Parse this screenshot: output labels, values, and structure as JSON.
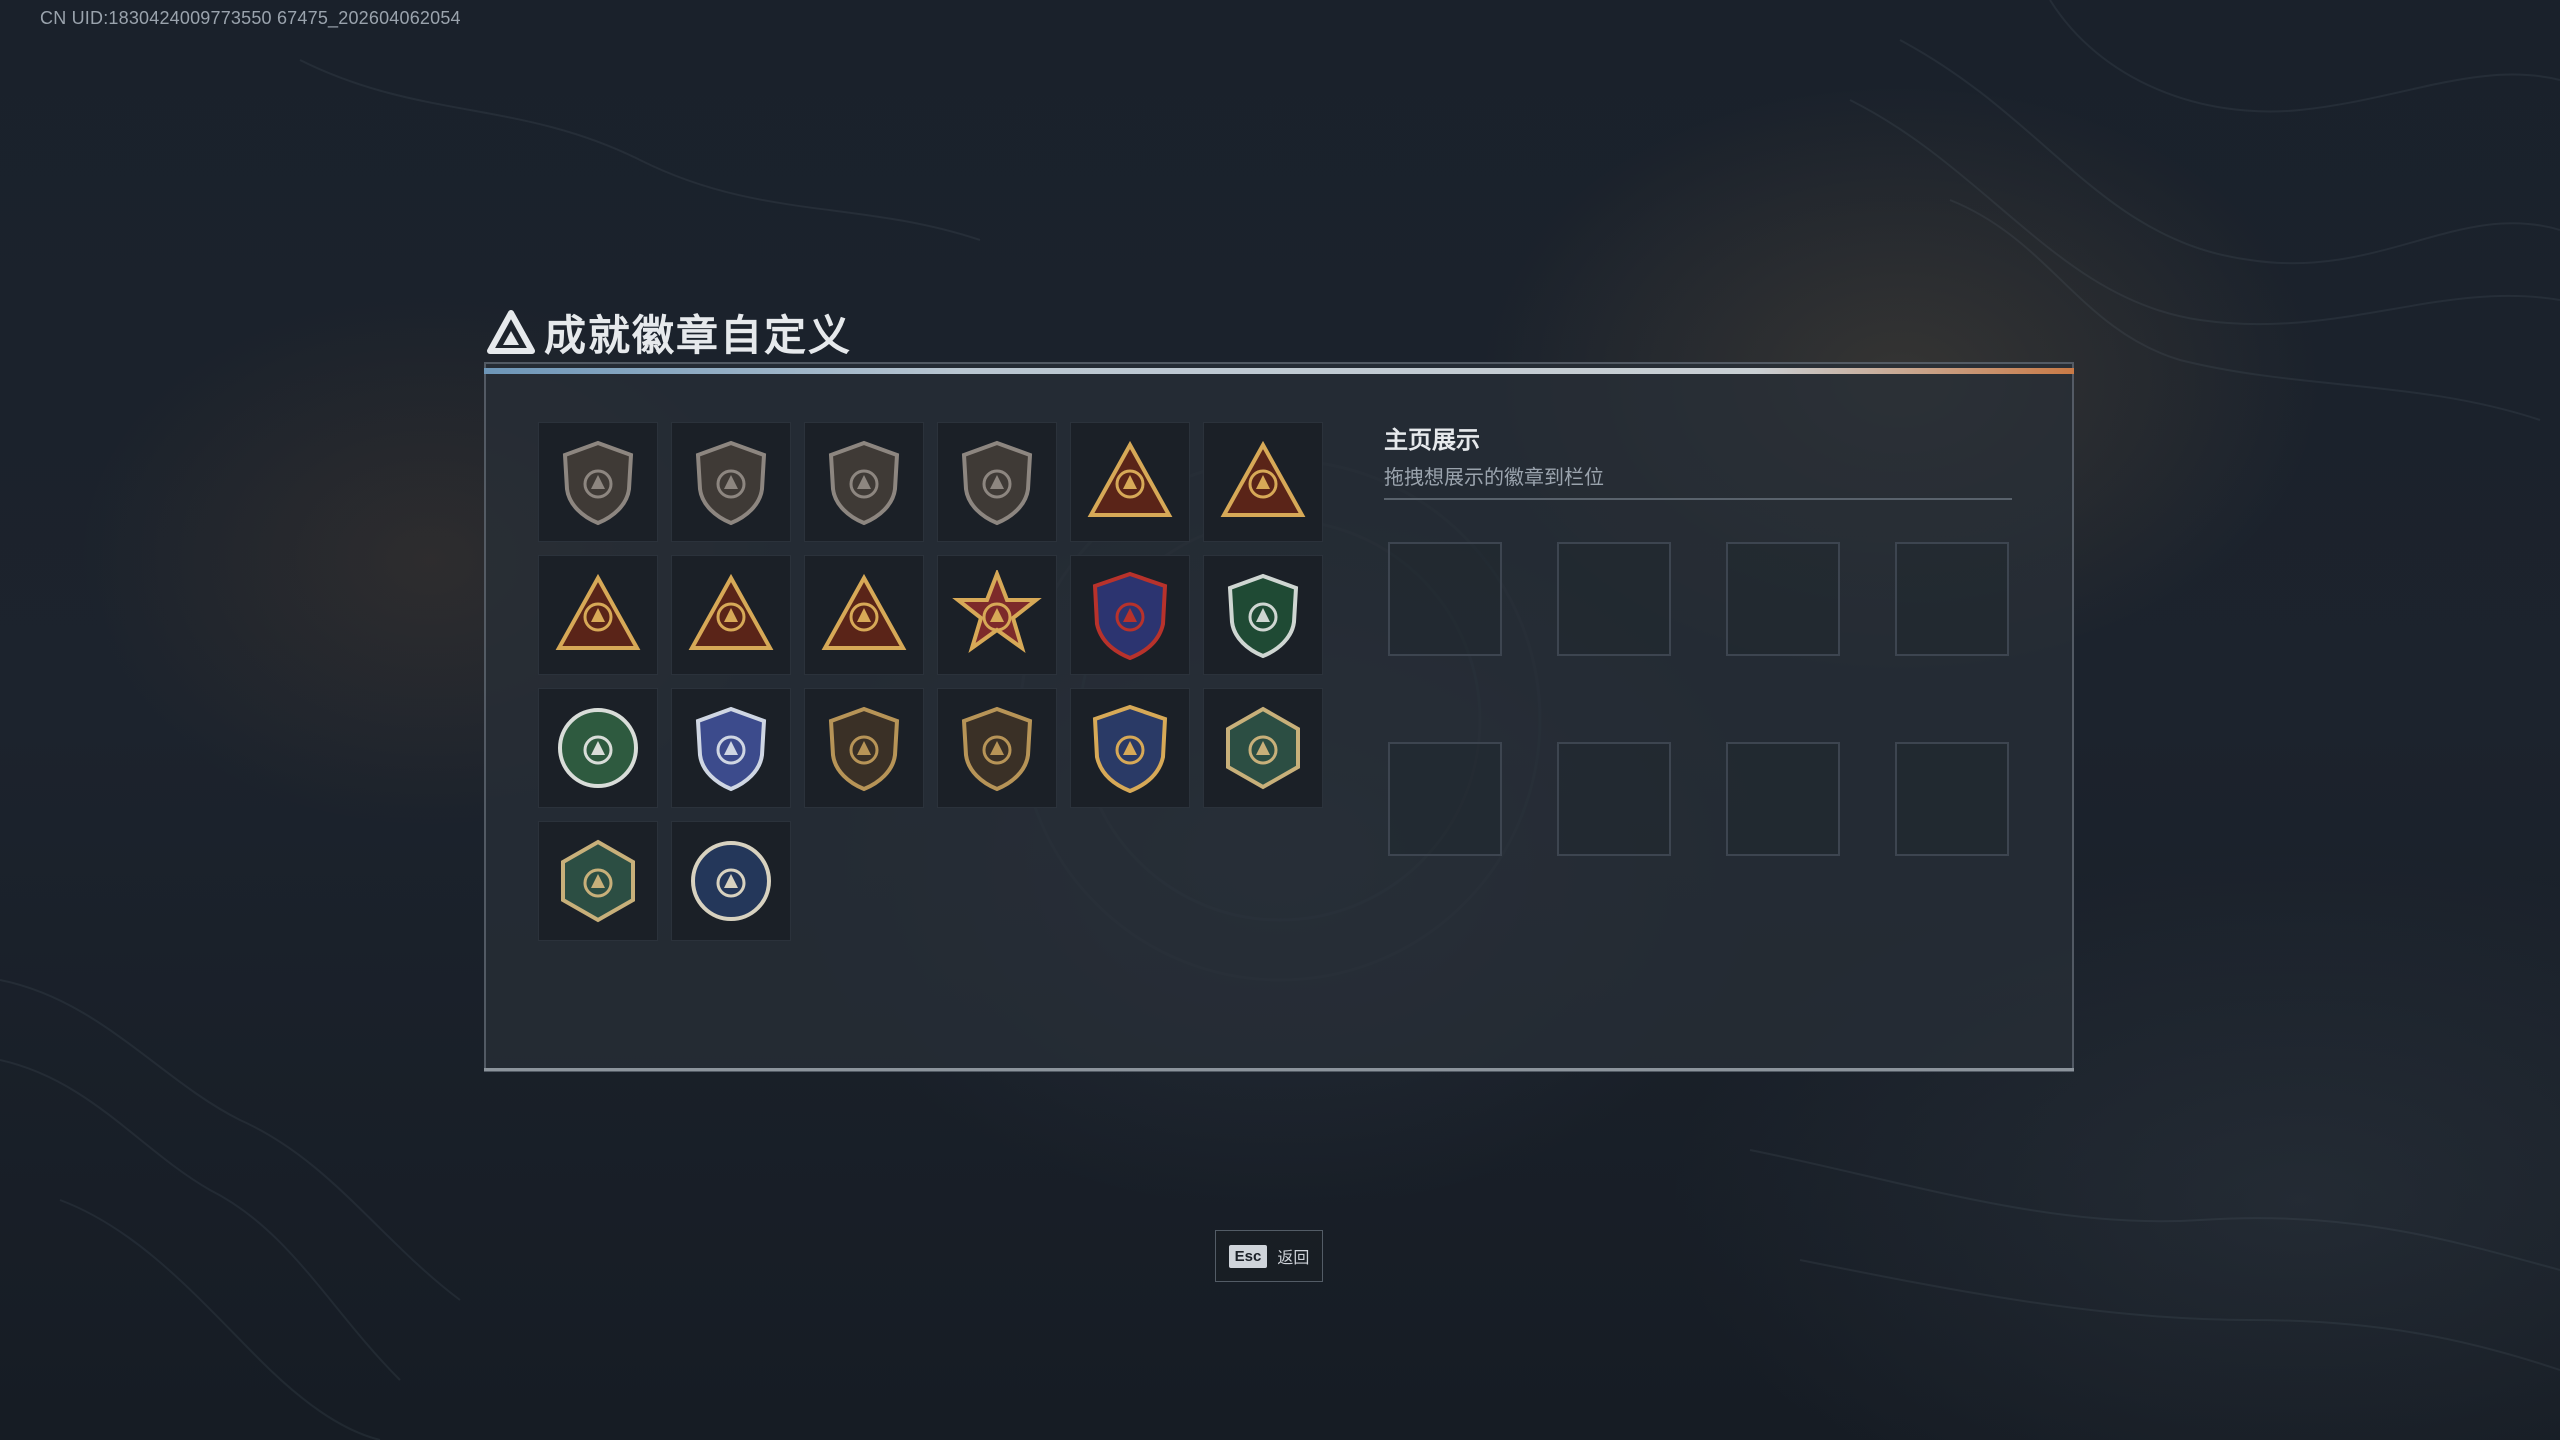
{
  "uid_text": "CN UID:1830424009773550 67475_202604062054",
  "page": {
    "title": "成就徽章自定义"
  },
  "badges": [
    {
      "name": "badge-delta-shield",
      "colors": [
        "#3f3a36",
        "#8d8680"
      ]
    },
    {
      "name": "badge-helicopter-shield",
      "colors": [
        "#3f3a36",
        "#8d8680"
      ]
    },
    {
      "name": "badge-diamond-shield",
      "colors": [
        "#3f3a36",
        "#8d8680"
      ]
    },
    {
      "name": "badge-dagger-shield",
      "colors": [
        "#3f3a36",
        "#8d8680"
      ]
    },
    {
      "name": "badge-gold-tower",
      "colors": [
        "#5a2418",
        "#d7a957"
      ]
    },
    {
      "name": "badge-gold-helmet",
      "colors": [
        "#5a2418",
        "#d7a957"
      ]
    },
    {
      "name": "badge-gold-tank",
      "colors": [
        "#5a2418",
        "#d7a957"
      ]
    },
    {
      "name": "badge-gold-number-one",
      "colors": [
        "#5a2418",
        "#d7a957"
      ]
    },
    {
      "name": "badge-gold-soldier",
      "colors": [
        "#5a2418",
        "#d7a957"
      ]
    },
    {
      "name": "badge-star-medal",
      "colors": [
        "#7d2a2a",
        "#d7a957"
      ]
    },
    {
      "name": "badge-crest-medal",
      "colors": [
        "#2c3470",
        "#b8322b"
      ]
    },
    {
      "name": "badge-green-shield",
      "colors": [
        "#1f4a34",
        "#cfd6d2"
      ]
    },
    {
      "name": "badge-green-skull",
      "colors": [
        "#2e5a3f",
        "#d9ddd9"
      ]
    },
    {
      "name": "badge-blue-sniper",
      "colors": [
        "#3c4b8c",
        "#cfd6e3"
      ]
    },
    {
      "name": "badge-rifle-shield",
      "colors": [
        "#3a3026",
        "#b79457"
      ]
    },
    {
      "name": "badge-rifle-shield-2",
      "colors": [
        "#3a3026",
        "#b79457"
      ]
    },
    {
      "name": "badge-gold-crosshair",
      "colors": [
        "#2a3a66",
        "#d7a957"
      ]
    },
    {
      "name": "badge-wasp-hex",
      "colors": [
        "#2c4e43",
        "#c8b07a"
      ]
    },
    {
      "name": "badge-wasp-hex-2",
      "colors": [
        "#2c4e43",
        "#c8b07a"
      ]
    },
    {
      "name": "badge-wolf-circle",
      "colors": [
        "#24375a",
        "#d8d2c0"
      ]
    }
  ],
  "showcase": {
    "title": "主页展示",
    "subtitle": "拖拽想展示的徽章到栏位",
    "slot_count": 8
  },
  "footer": {
    "esc_key": "Esc",
    "esc_label": "返回"
  }
}
